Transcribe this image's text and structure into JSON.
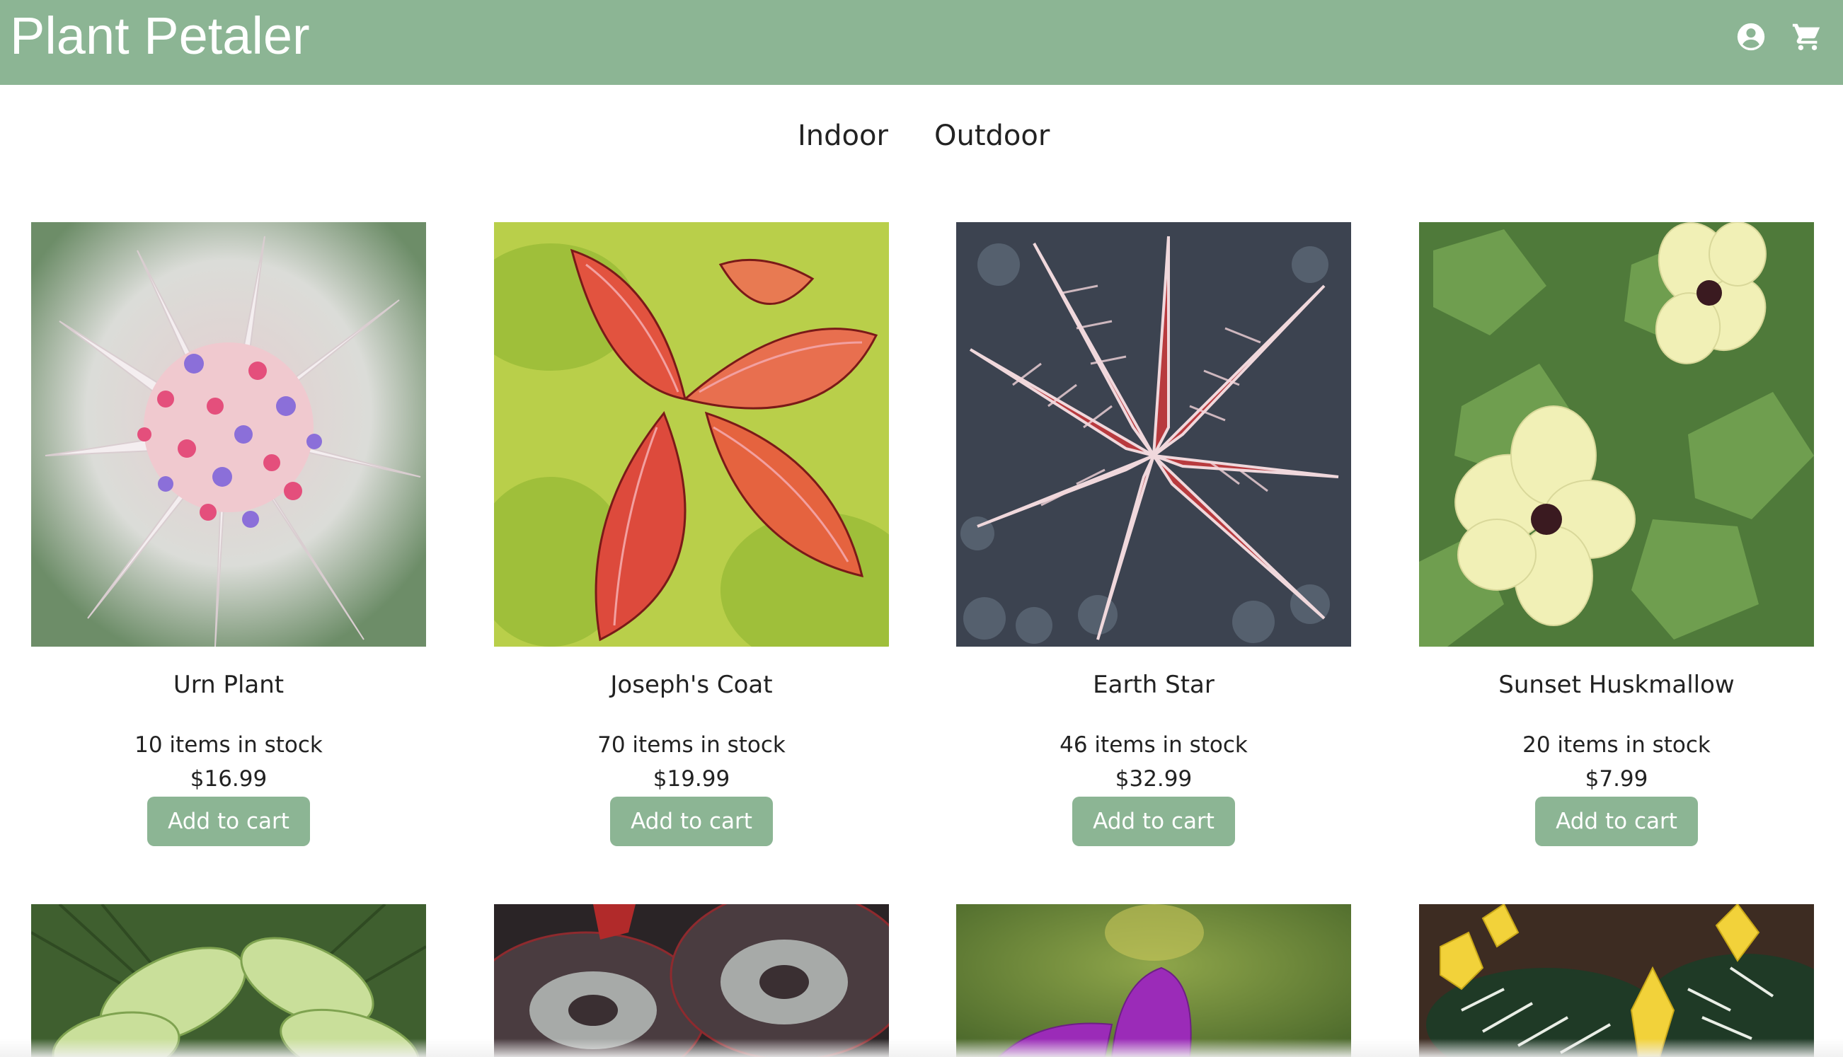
{
  "header": {
    "brand": "Plant Petaler",
    "account_icon": "account-circle-icon",
    "cart_icon": "shopping-cart-icon",
    "color": "#8cb594"
  },
  "nav": {
    "items": [
      {
        "label": "Indoor"
      },
      {
        "label": "Outdoor"
      }
    ]
  },
  "products": [
    {
      "name": "Urn Plant",
      "stock": "10 items in stock",
      "price": "$16.99",
      "button": "Add to cart"
    },
    {
      "name": "Joseph's Coat",
      "stock": "70 items in stock",
      "price": "$19.99",
      "button": "Add to cart"
    },
    {
      "name": "Earth Star",
      "stock": "46 items in stock",
      "price": "$32.99",
      "button": "Add to cart"
    },
    {
      "name": "Sunset Huskmallow",
      "stock": "20 items in stock",
      "price": "$7.99",
      "button": "Add to cart"
    }
  ],
  "colors": {
    "accent": "#8cb594",
    "button_text": "#ffffff"
  }
}
